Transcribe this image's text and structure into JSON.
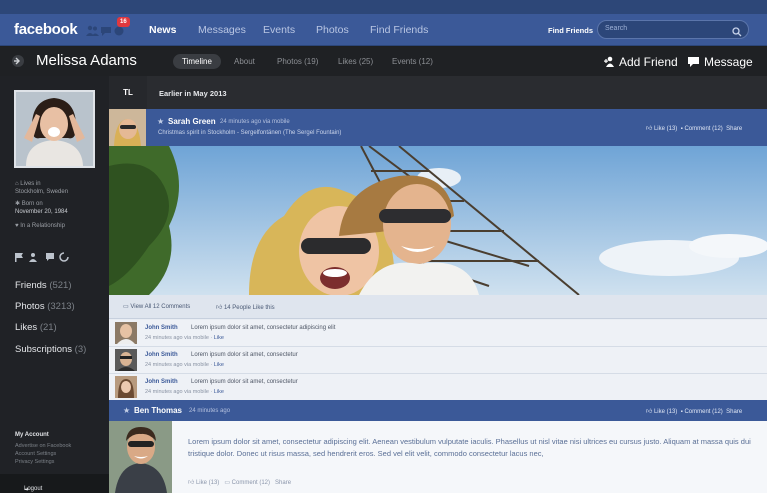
{
  "topbar": {
    "logo": "facebook",
    "notification_count": "16",
    "nav": [
      "News",
      "Messages",
      "Events",
      "Photos",
      "Find Friends"
    ],
    "find_friends_label": "Find Friends",
    "search_placeholder": "Search"
  },
  "profile": {
    "name": "Melissa Adams",
    "tabs": [
      "Timeline",
      "About",
      "Photos (19)",
      "Likes (25)",
      "Events (12)"
    ],
    "add_friend": "Add Friend",
    "message": "Message"
  },
  "sidebar": {
    "lives_label": "Lives in",
    "lives_value": "Stockholm, Sweden",
    "born_label": "Born on",
    "born_value": "November 20, 1984",
    "relationship": "In a Relationship",
    "links": [
      {
        "label": "Friends",
        "count": "(521)"
      },
      {
        "label": "Photos",
        "count": "(3213)"
      },
      {
        "label": "Likes",
        "count": "(21)"
      },
      {
        "label": "Subscriptions",
        "count": "(3)"
      }
    ],
    "account_title": "My Account",
    "account_links": [
      "Advertise on Facebook",
      "Account Settings",
      "Privacy Settings"
    ],
    "logout": "Logout"
  },
  "timeline": {
    "tl_label": "TL",
    "period": "Earlier in May 2013"
  },
  "post1": {
    "author": "Sarah Green",
    "time": "24 minutes ago via mobile",
    "location": "Christmas spirit in Stockholm - Sergelfontänen (The Sergel Fountain)",
    "like": "Like (13)",
    "comment": "Comment (12)",
    "share": "Share",
    "view_comments": "View All 12 Comments",
    "people_like": "14 People Like this",
    "comments": [
      {
        "name": "John Smith",
        "text": "Lorem ipsum dolor sit amet, consectetur adipiscing elit",
        "meta": "24 minutes ago via mobile",
        "like": "Like"
      },
      {
        "name": "John Smith",
        "text": "Lorem ipsum dolor sit amet, consectetur",
        "meta": "24 minutes ago via mobile",
        "like": "Like"
      },
      {
        "name": "John Smith",
        "text": "Lorem ipsum dolor sit amet, consectetur",
        "meta": "24 minutes ago via mobile",
        "like": "Like"
      }
    ]
  },
  "post2": {
    "author": "Ben Thomas",
    "time": "24 minutes ago",
    "like": "Like (13)",
    "comment": "Comment (12)",
    "share": "Share",
    "body": "Lorem ipsum dolor sit amet, consectetur adipiscing elit. Aenean vestibulum vulputate iaculis. Phasellus ut nisl vitae nisi ultrices eu cursus justo. Aliquam at massa quis dui tristique dolor. Donec ut risus massa, sed hendrerit eros. Sed vel elit velit, commodo consectetur lacus nec,",
    "foot_like": "Like (13)",
    "foot_comment": "Comment (12)",
    "foot_share": "Share"
  },
  "colors": {
    "brand": "#3b5998",
    "dark": "#1e2022",
    "badge": "#e0383e"
  }
}
